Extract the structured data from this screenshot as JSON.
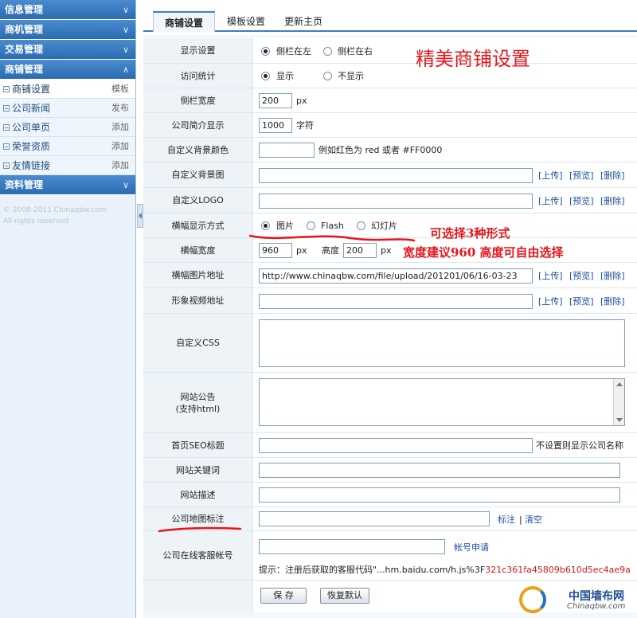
{
  "sidebar": {
    "sections": [
      {
        "label": "信息管理"
      },
      {
        "label": "商机管理"
      },
      {
        "label": "交易管理"
      },
      {
        "label": "商铺管理"
      }
    ],
    "items": [
      {
        "label": "商铺设置",
        "action": "模板"
      },
      {
        "label": "公司新闻",
        "action": "发布"
      },
      {
        "label": "公司单页",
        "action": "添加"
      },
      {
        "label": "荣誉资质",
        "action": "添加"
      },
      {
        "label": "友情链接",
        "action": "添加"
      }
    ],
    "last_section": {
      "label": "资料管理"
    },
    "copyright_line1": "© 2008-2011 Chinaqbw.com",
    "copyright_line2": "All rights reserved"
  },
  "tabs": [
    {
      "label": "商铺设置"
    },
    {
      "label": "模板设置"
    },
    {
      "label": "更新主页"
    }
  ],
  "form": {
    "display": {
      "label": "显示设置",
      "opt1": "侧栏在左",
      "opt2": "侧栏在右"
    },
    "stats": {
      "label": "访问统计",
      "opt1": "显示",
      "opt2": "不显示"
    },
    "sidebar_width": {
      "label": "侧栏宽度",
      "value": "200",
      "unit": "px"
    },
    "intro": {
      "label": "公司简介显示",
      "value": "1000",
      "unit": "字符"
    },
    "bg_color": {
      "label": "自定义背景颜色",
      "value": "",
      "hint": "例如红色为 red 或者 #FF0000"
    },
    "bg_image": {
      "label": "自定义背景图",
      "value": ""
    },
    "logo": {
      "label": "自定义LOGO",
      "value": ""
    },
    "banner_mode": {
      "label": "横幅显示方式",
      "opt1": "图片",
      "opt2": "Flash",
      "opt3": "幻灯片"
    },
    "banner_width": {
      "label": "横幅宽度",
      "value": "960",
      "unit": "px",
      "height_label": "高度",
      "height_value": "200",
      "height_unit": "px"
    },
    "banner_url": {
      "label": "横幅图片地址",
      "value": "http://www.chinaqbw.com/file/upload/201201/06/16-03-23"
    },
    "video_url": {
      "label": "形象视频地址",
      "value": ""
    },
    "css": {
      "label": "自定义CSS"
    },
    "notice": {
      "label": "网站公告",
      "label2": "(支持html)"
    },
    "seo_title": {
      "label": "首页SEO标题",
      "value": "",
      "hint": "不设置则显示公司名称"
    },
    "keywords": {
      "label": "网站关键词",
      "value": ""
    },
    "description": {
      "label": "网站描述",
      "value": ""
    },
    "map": {
      "label": "公司地图标注",
      "value": "",
      "link1": "标注",
      "sep": "|",
      "link2": "清空"
    },
    "service": {
      "label": "公司在线客服帐号",
      "value": "",
      "link": "帐号申请",
      "tip": "提示：注册后获取的客服代码\"...hm.baidu.com/h.js%3F",
      "tip_red": "321c361fa45809b610d5ec4ae9a"
    }
  },
  "file_links": {
    "upload": "[上传]",
    "preview": "[预览]",
    "delete": "[删除]"
  },
  "buttons": {
    "save": "保 存",
    "reset": "恢复默认"
  },
  "annotations": {
    "title": "精美商铺设置",
    "note1": "可选择3种形式",
    "note2": "宽度建议960  高度可自由选择"
  },
  "logo": {
    "name": "中国墙布网",
    "domain": "Chinaqbw.com"
  },
  "colors": {
    "accent": "#2b6cb0",
    "annotation": "#e8151b",
    "link": "#1a4fa3"
  }
}
